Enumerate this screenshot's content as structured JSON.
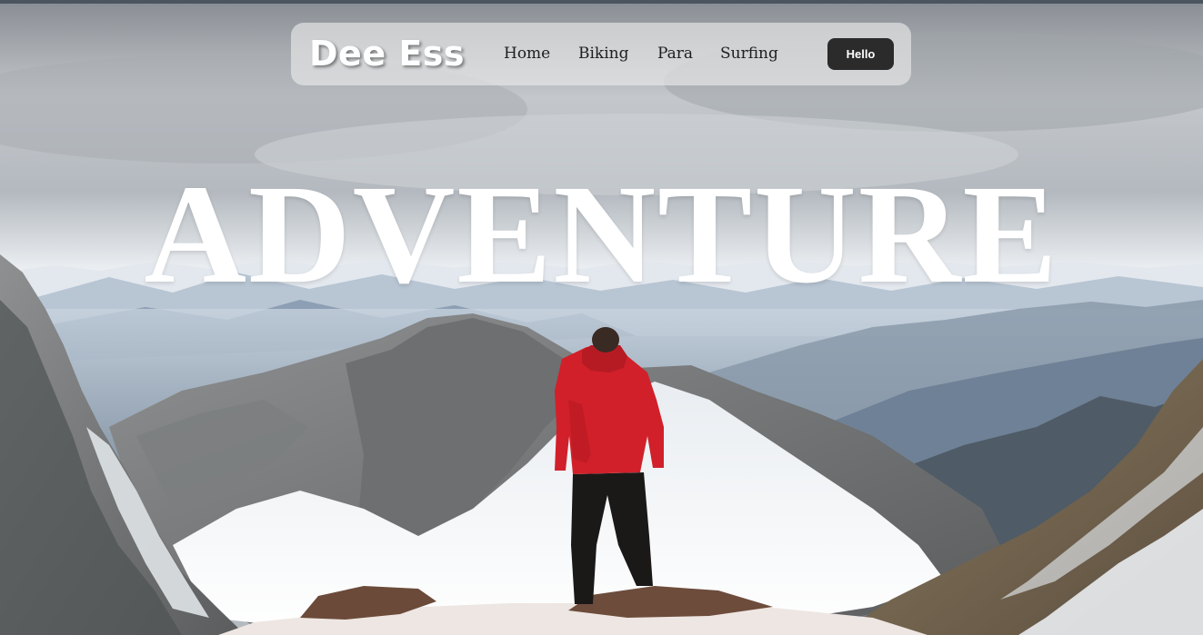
{
  "nav": {
    "logo": "Dee Ess",
    "links": [
      "Home",
      "Biking",
      "Para",
      "Surfing"
    ],
    "cta_label": "Hello"
  },
  "hero": {
    "headline": "ADVENTURE",
    "background_icon": "mountain-hiker-photo",
    "colors": {
      "text": "#ffffff",
      "button_bg": "#2b2b2b",
      "jacket": "#d1202a"
    }
  }
}
